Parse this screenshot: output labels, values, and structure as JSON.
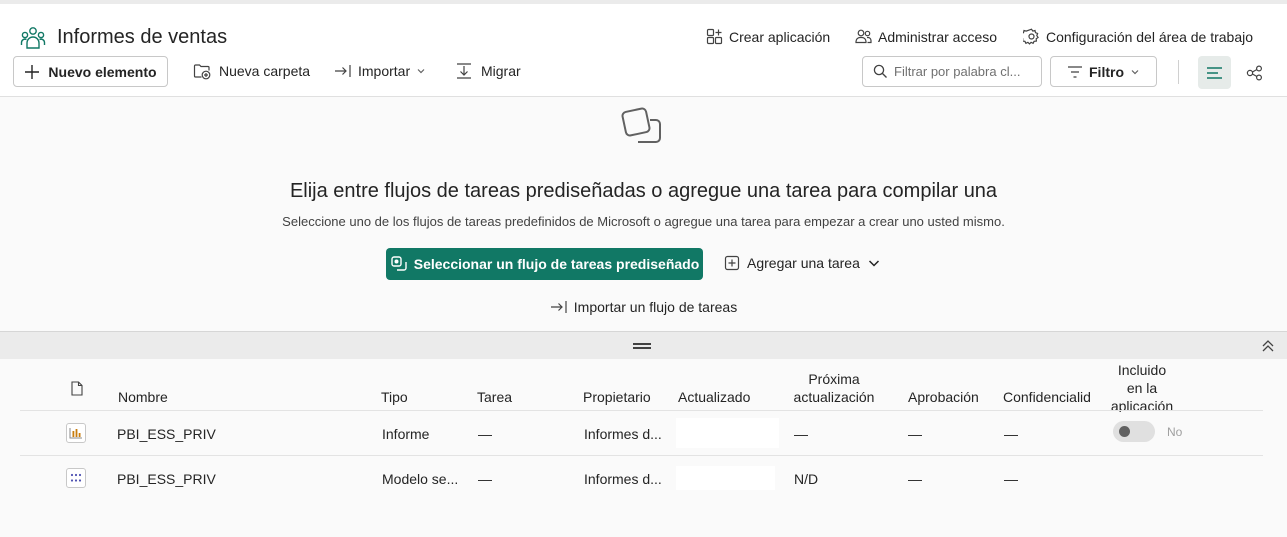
{
  "workspace": {
    "title": "Informes de ventas",
    "actions": {
      "create_app": "Crear aplicación",
      "manage_access": "Administrar acceso",
      "workspace_settings": "Configuración del área de trabajo"
    }
  },
  "toolbar": {
    "new_item": "Nuevo elemento",
    "new_folder": "Nueva carpeta",
    "import": "Importar",
    "migrate": "Migrar",
    "search_placeholder": "Filtrar por palabra cl...",
    "filter": "Filtro"
  },
  "empty_state": {
    "title": "Elija entre flujos de tareas prediseñadas o agregue una tarea para compilar una",
    "description": "Seleccione uno de los flujos de tareas predefinidos de Microsoft o agregue una tarea para empezar a crear uno usted mismo.",
    "primary_button": "Seleccionar un flujo de tareas prediseñado",
    "add_task": "Agregar una tarea",
    "import_flow": "Importar un flujo de tareas"
  },
  "table": {
    "columns": {
      "name": "Nombre",
      "type": "Tipo",
      "task": "Tarea",
      "owner": "Propietario",
      "refreshed": "Actualizado",
      "next_refresh_1": "Próxima",
      "next_refresh_2": "actualización",
      "endorsement": "Aprobación",
      "sensitivity": "Confidencialid",
      "in_app_1": "Incluido",
      "in_app_2": "en la",
      "in_app_3": "aplicación"
    },
    "rows": [
      {
        "icon": "report-icon",
        "name": "PBI_ESS_PRIV",
        "type": "Informe",
        "task": "—",
        "owner": "Informes d...",
        "next_refresh": "—",
        "endorsement": "—",
        "sensitivity": "—",
        "in_app": "No"
      },
      {
        "icon": "semantic-model-icon",
        "name": "PBI_ESS_PRIV",
        "type": "Modelo se...",
        "task": "—",
        "owner": "Informes d...",
        "next_refresh": "N/D",
        "endorsement": "—",
        "sensitivity": "—"
      }
    ]
  },
  "colors": {
    "accent": "#117865",
    "report_bars": "#c87d0e",
    "model_dots": "#4f52b2"
  }
}
